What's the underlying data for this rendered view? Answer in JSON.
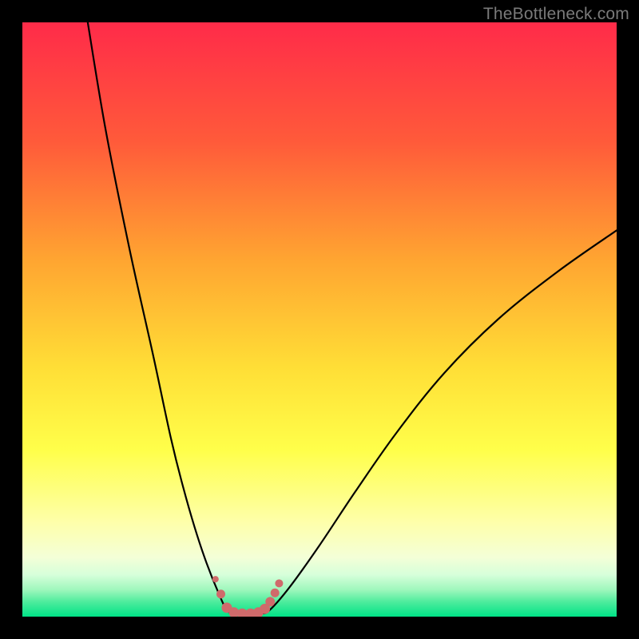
{
  "watermark": "TheBottleneck.com",
  "colors": {
    "page_bg": "#000000",
    "gradient_top": "#ff2b49",
    "gradient_mid1": "#ff7a2e",
    "gradient_mid2": "#ffd236",
    "gradient_mid3": "#ffff4a",
    "gradient_low": "#f5ffc0",
    "gradient_bottom": "#00e387",
    "curve": "#000000",
    "dots": "#cf6a6b"
  },
  "chart_data": {
    "type": "line",
    "title": "",
    "xlabel": "",
    "ylabel": "",
    "xlim": [
      0,
      100
    ],
    "ylim": [
      0,
      100
    ],
    "annotations": [],
    "series": [
      {
        "name": "left-branch",
        "x": [
          11,
          14,
          18,
          22,
          25,
          27,
          29,
          31,
          33,
          34.5
        ],
        "values": [
          100,
          82,
          62,
          44,
          30,
          22,
          15,
          9,
          4,
          1
        ]
      },
      {
        "name": "valley-floor",
        "x": [
          34.5,
          36,
          38,
          40,
          41.5
        ],
        "values": [
          1,
          0.5,
          0.5,
          0.6,
          1
        ]
      },
      {
        "name": "right-branch",
        "x": [
          41.5,
          45,
          50,
          56,
          63,
          71,
          80,
          90,
          100
        ],
        "values": [
          1,
          5,
          12,
          21,
          31,
          41,
          50,
          58,
          65
        ]
      }
    ],
    "markers": {
      "name": "valley-dots",
      "color": "#cf6a6b",
      "points": [
        {
          "x": 32.5,
          "y": 6.3,
          "r": 4
        },
        {
          "x": 33.4,
          "y": 3.8,
          "r": 5.5
        },
        {
          "x": 34.4,
          "y": 1.5,
          "r": 6.5
        },
        {
          "x": 35.6,
          "y": 0.7,
          "r": 6.5
        },
        {
          "x": 37.0,
          "y": 0.5,
          "r": 6.5
        },
        {
          "x": 38.4,
          "y": 0.5,
          "r": 6.5
        },
        {
          "x": 39.7,
          "y": 0.7,
          "r": 6.5
        },
        {
          "x": 40.8,
          "y": 1.3,
          "r": 6.5
        },
        {
          "x": 41.7,
          "y": 2.5,
          "r": 6
        },
        {
          "x": 42.5,
          "y": 4.0,
          "r": 5.5
        },
        {
          "x": 43.2,
          "y": 5.6,
          "r": 5
        }
      ]
    }
  }
}
